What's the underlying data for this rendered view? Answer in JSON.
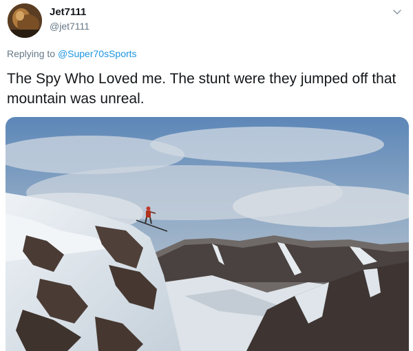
{
  "user": {
    "display_name": "Jet7111",
    "handle": "@jet7111",
    "avatar_icon": "profile-photo"
  },
  "reply": {
    "prefix": "Replying to ",
    "mention": "@Super70sSports"
  },
  "tweet": {
    "text": "The Spy Who Loved me. The stunt were they jumped off that mountain was unreal."
  },
  "menu": {
    "icon": "chevron-down-icon"
  },
  "colors": {
    "link": "#1b95e0",
    "secondary_text": "#657786",
    "primary_text": "#14171a"
  }
}
